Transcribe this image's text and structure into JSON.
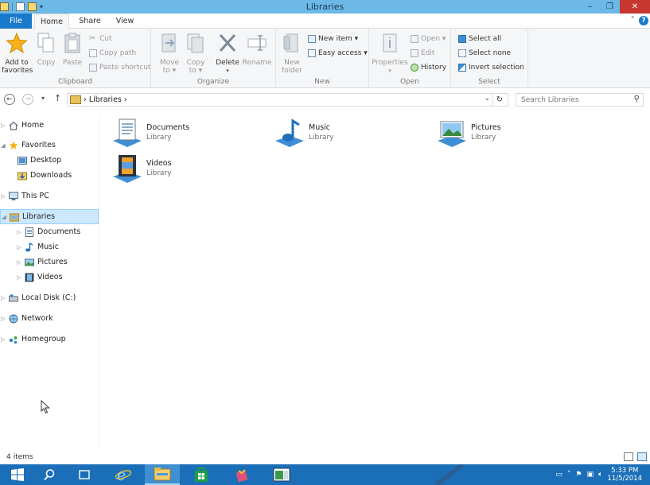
{
  "window": {
    "title": "Libraries",
    "minimize": "‒",
    "maximize": "❐",
    "close": "✕"
  },
  "ribbon_tabs": {
    "file": "File",
    "home": "Home",
    "share": "Share",
    "view": "View",
    "help": "?"
  },
  "ribbon": {
    "clipboard": {
      "label": "Clipboard",
      "add_to_favorites_l1": "Add to",
      "add_to_favorites_l2": "favorites",
      "copy": "Copy",
      "paste": "Paste",
      "cut": "Cut",
      "copy_path": "Copy path",
      "paste_shortcut": "Paste shortcut"
    },
    "organize": {
      "label": "Organize",
      "move_to_l1": "Move",
      "move_to_l2": "to ▾",
      "copy_to_l1": "Copy",
      "copy_to_l2": "to ▾",
      "delete": "Delete",
      "rename": "Rename"
    },
    "new": {
      "label": "New",
      "new_folder_l1": "New",
      "new_folder_l2": "folder",
      "new_item": "New item ▾",
      "easy_access": "Easy access ▾"
    },
    "open": {
      "label": "Open",
      "properties": "Properties",
      "open": "Open ▾",
      "edit": "Edit",
      "history": "History"
    },
    "select": {
      "label": "Select",
      "select_all": "Select all",
      "select_none": "Select none",
      "invert_selection": "Invert selection"
    }
  },
  "address": {
    "path": "Libraries",
    "search_placeholder": "Search Libraries"
  },
  "nav": {
    "home": "Home",
    "favorites": "Favorites",
    "desktop": "Desktop",
    "downloads": "Downloads",
    "this_pc": "This PC",
    "libraries": "Libraries",
    "documents": "Documents",
    "music": "Music",
    "pictures": "Pictures",
    "videos": "Videos",
    "local_disk": "Local Disk (C:)",
    "network": "Network",
    "homegroup": "Homegroup"
  },
  "content": {
    "items": [
      {
        "name": "Documents",
        "type": "Library"
      },
      {
        "name": "Music",
        "type": "Library"
      },
      {
        "name": "Pictures",
        "type": "Library"
      },
      {
        "name": "Videos",
        "type": "Library"
      }
    ]
  },
  "status": {
    "count": "4 items"
  },
  "taskbar": {
    "time": "5:33 PM",
    "date": "11/5/2014"
  },
  "colors": {
    "titlebar": "#6cb8e6",
    "accent": "#1979ca",
    "taskbar": "#1b6fb8",
    "selection": "#cce8ff"
  }
}
